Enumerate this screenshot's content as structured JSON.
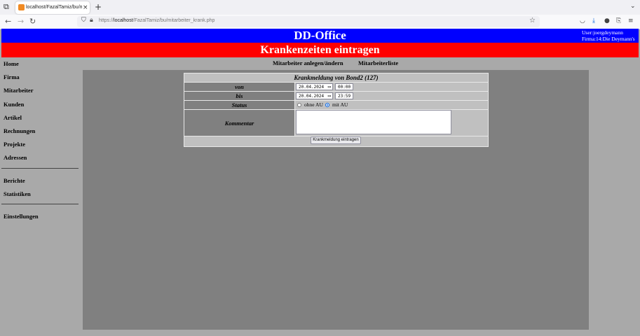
{
  "browser": {
    "tab_title": "localhost/FazalTamiz/bu/mitarb",
    "tab_close": "×",
    "new_tab": "+",
    "url_prefix": "https://",
    "url_host": "localhost",
    "url_path": "/FazalTamiz/bu/mitarbeiter_krank.php",
    "icons": [
      "tab-list-icon",
      "back-icon",
      "forward-icon",
      "reload-icon",
      "shield-icon",
      "lock-icon",
      "bookmark-star-icon",
      "pocket-icon",
      "download-icon",
      "account-icon",
      "extensions-icon",
      "menu-icon"
    ]
  },
  "header": {
    "app_title": "DD-Office",
    "user_line": "User:joergdeymann",
    "company_line": "Firma:14:Die Deymann's",
    "page_title": "Krankenzeiten eintragen",
    "blue": "#0000ff",
    "red": "#ff0000"
  },
  "sidebar": {
    "items_top": [
      "Home",
      "Firma",
      "Mitarbeiter",
      "Kunden",
      "Artikel",
      "Rechnungen",
      "Projekte",
      "Adressen"
    ],
    "items_mid": [
      "Berichte",
      "Statistiken"
    ],
    "items_bottom": [
      "Einstellungen"
    ]
  },
  "topnav": {
    "item1": "Mitarbeiter anlegen/ändern",
    "item2": "Mitarbeiterliste"
  },
  "form": {
    "header": "Krankmeldung von Bond2 (127)",
    "von_label": "von",
    "von_date": "20.04.2024",
    "von_time": "00:00",
    "bis_label": "bis",
    "bis_date": "20.04.2024",
    "bis_time": "23:59",
    "status_label": "Status",
    "status_option1": "ohne AU",
    "status_option2": "mit AU",
    "status_selected": "mit AU",
    "kommentar_label": "Kommentar",
    "kommentar_value": "",
    "submit_label": "Krankmeldung eintragen"
  }
}
